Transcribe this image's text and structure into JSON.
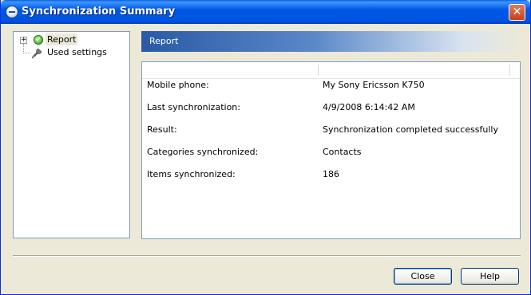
{
  "window": {
    "title": "Synchronization Summary"
  },
  "tree": {
    "items": [
      {
        "label": "Report",
        "icon": "ok-icon",
        "selected": true,
        "expander": "+"
      },
      {
        "label": "Used settings",
        "icon": "wrench-icon"
      }
    ]
  },
  "report": {
    "header": "Report",
    "rows": [
      {
        "label": "Mobile phone:",
        "value": "My Sony Ericsson K750"
      },
      {
        "label": "Last synchronization:",
        "value": "4/9/2008 6:14:42 AM"
      },
      {
        "label": "Result:",
        "value": "Synchronization completed successfully"
      },
      {
        "label": "Categories synchronized:",
        "value": "Contacts"
      },
      {
        "label": "Items synchronized:",
        "value": "186"
      }
    ]
  },
  "buttons": {
    "close": "Close",
    "help": "Help"
  },
  "colors": {
    "titlebar": "#0058e6",
    "header_gradient_start": "#2a5aa6",
    "dialog_bg": "#ece9d8"
  }
}
